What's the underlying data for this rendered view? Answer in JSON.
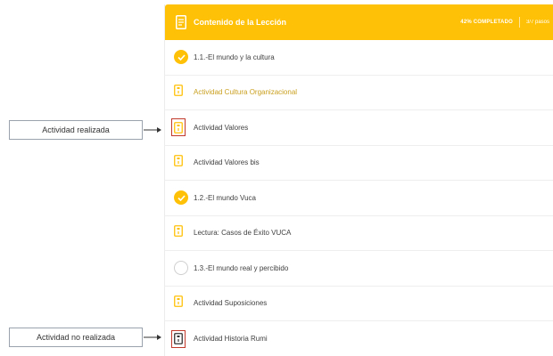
{
  "header": {
    "title": "Contenido de la Lección",
    "progress": "42% COMPLETADO",
    "steps": "3/7 pasos"
  },
  "items": [
    {
      "label": "1.1.-El mundo y la cultura",
      "icon": "check-icon"
    },
    {
      "label": "Actividad Cultura Organizacional",
      "icon": "document-icon"
    },
    {
      "label": "Actividad Valores",
      "icon": "document-icon"
    },
    {
      "label": "Actividad Valores bis",
      "icon": "document-icon"
    },
    {
      "label": "1.2.-El mundo Vuca",
      "icon": "check-icon"
    },
    {
      "label": "Lectura: Casos de Éxito VUCA",
      "icon": "document-icon"
    },
    {
      "label": "1.3.-El mundo real y percibido",
      "icon": "empty-circle-icon"
    },
    {
      "label": "Actividad Suposiciones",
      "icon": "document-icon"
    },
    {
      "label": "Actividad Historia Rumi",
      "icon": "document-icon"
    }
  ],
  "callouts": {
    "done": "Actividad realizada",
    "not_done": "Actividad no realizada"
  },
  "colors": {
    "accent": "#ffc107",
    "highlight_text": "#caa020",
    "annotation_border": "#c0392b"
  }
}
